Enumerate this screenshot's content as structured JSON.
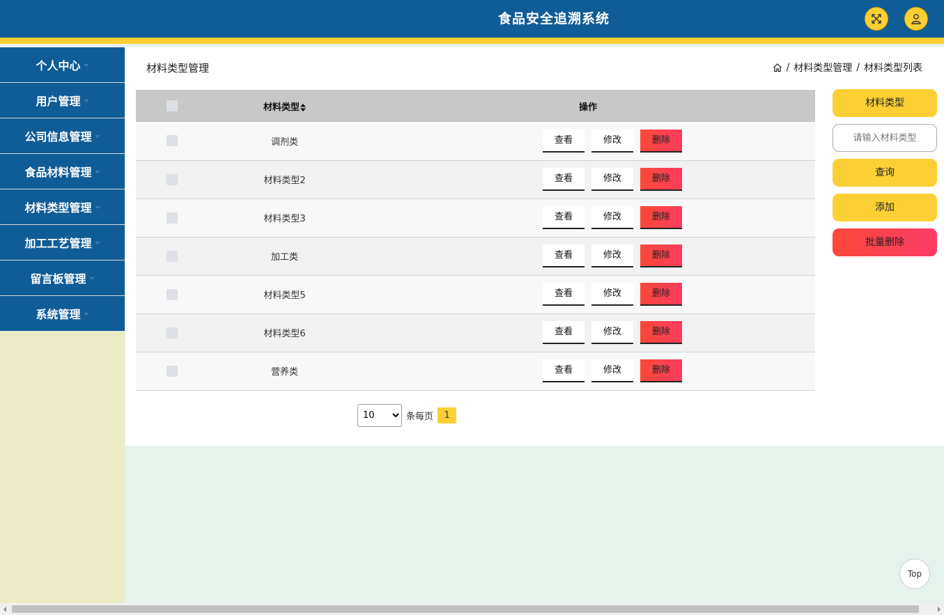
{
  "header": {
    "title": "食品安全追溯系统",
    "fullscreen_icon": "expand-icon",
    "user_icon": "user-icon"
  },
  "sidebar": {
    "items": [
      {
        "label": "个人中心"
      },
      {
        "label": "用户管理"
      },
      {
        "label": "公司信息管理"
      },
      {
        "label": "食品材料管理"
      },
      {
        "label": "材料类型管理"
      },
      {
        "label": "加工工艺管理"
      },
      {
        "label": "留言板管理"
      },
      {
        "label": "系统管理"
      }
    ]
  },
  "main": {
    "heading": "材料类型管理",
    "breadcrumb": [
      "材料类型管理",
      "材料类型列表"
    ],
    "breadcrumb_separator": "/",
    "table": {
      "columns": [
        "材料类型",
        "操作"
      ],
      "rows": [
        {
          "type": "调剂类"
        },
        {
          "type": "材料类型2"
        },
        {
          "type": "材料类型3"
        },
        {
          "type": "加工类"
        },
        {
          "type": "材料类型5"
        },
        {
          "type": "材料类型6"
        },
        {
          "type": "营养类"
        }
      ],
      "actions": {
        "view": "查看",
        "edit": "修改",
        "delete": "删除"
      }
    },
    "pagination": {
      "page_size": "10",
      "page_size_options": [
        "10"
      ],
      "per_page_label": "条每页",
      "current_page": "1"
    }
  },
  "side_panel": {
    "field_label": "材料类型",
    "search_placeholder": "请输入材料类型",
    "query_label": "查询",
    "add_label": "添加",
    "batch_delete_label": "批量删除"
  },
  "back_to_top": "Top",
  "colors": {
    "primary": "#105c96",
    "accent": "#fcd034",
    "danger": "#fb4838",
    "sidebar_bg": "#ecedc8",
    "page_bg": "#e6f2ec"
  }
}
